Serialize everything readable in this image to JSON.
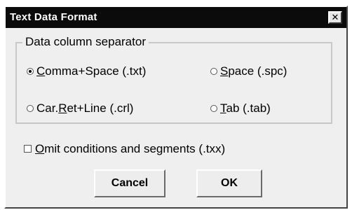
{
  "window": {
    "title": "Text Data Format",
    "close_glyph": "✕"
  },
  "separator_group": {
    "legend": "Data column separator",
    "options": [
      {
        "pre": "",
        "mnemonic": "C",
        "post": "omma+Space (.txt)",
        "checked": true
      },
      {
        "pre": "",
        "mnemonic": "S",
        "post": "pace (.spc)",
        "checked": false
      },
      {
        "pre": "Car.",
        "mnemonic": "R",
        "post": "et+Line (.crl)",
        "checked": false
      },
      {
        "pre": "",
        "mnemonic": "T",
        "post": "ab (.tab)",
        "checked": false
      }
    ]
  },
  "omit_checkbox": {
    "mnemonic": "O",
    "post": "mit conditions and segments (.txx)",
    "checked": false
  },
  "buttons": {
    "cancel": "Cancel",
    "ok": "OK"
  }
}
